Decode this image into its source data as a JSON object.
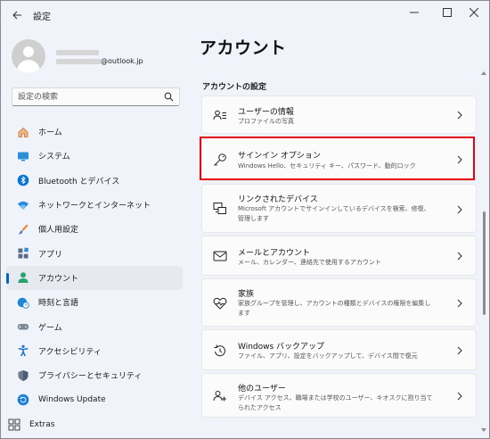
{
  "window": {
    "app_title": "設定",
    "back_icon": "back-arrow-icon",
    "minimize_icon": "minimize-icon",
    "maximize_icon": "maximize-icon",
    "close_icon": "close-icon"
  },
  "profile": {
    "email_suffix": "@outlook.jp"
  },
  "search": {
    "placeholder": "設定の検索"
  },
  "nav": {
    "items": [
      {
        "label": "ホーム",
        "icon": "home-icon"
      },
      {
        "label": "システム",
        "icon": "system-icon"
      },
      {
        "label": "Bluetooth とデバイス",
        "icon": "bluetooth-icon"
      },
      {
        "label": "ネットワークとインターネット",
        "icon": "wifi-icon"
      },
      {
        "label": "個人用設定",
        "icon": "brush-icon"
      },
      {
        "label": "アプリ",
        "icon": "apps-icon"
      },
      {
        "label": "アカウント",
        "icon": "account-icon",
        "active": true
      },
      {
        "label": "時刻と言語",
        "icon": "globe-clock-icon"
      },
      {
        "label": "ゲーム",
        "icon": "gamepad-icon"
      },
      {
        "label": "アクセシビリティ",
        "icon": "accessibility-icon"
      },
      {
        "label": "プライバシーとセキュリティ",
        "icon": "shield-icon"
      },
      {
        "label": "Windows Update",
        "icon": "update-icon"
      }
    ],
    "extras": "Extras"
  },
  "main": {
    "title": "アカウント",
    "section": "アカウントの設定",
    "cards": [
      {
        "title": "ユーザーの情報",
        "desc": "プロファイルの写真",
        "icon": "user-info-icon"
      },
      {
        "title": "サインイン オプション",
        "desc": "Windows Hello、セキュリティ キー、パスワード、動的ロック",
        "icon": "key-icon"
      },
      {
        "title": "リンクされたデバイス",
        "desc": "Microsoft アカウントでサインインしているデバイスを検索、修復、管理します",
        "icon": "linked-devices-icon"
      },
      {
        "title": "メールとアカウント",
        "desc": "メール、カレンダー、連絡先で使用するアカウント",
        "icon": "mail-icon"
      },
      {
        "title": "家族",
        "desc": "家族グループを管理し、アカウントの種類とデバイスの権限を編集します",
        "icon": "family-heart-icon"
      },
      {
        "title": "Windows バックアップ",
        "desc": "ファイル、アプリ、設定をバックアップして、デバイス間で復元",
        "icon": "backup-icon"
      },
      {
        "title": "他のユーザー",
        "desc": "デバイス アクセス、職場または学校のユーザー、キオスクに割り当てられたアクセス",
        "icon": "other-users-icon"
      }
    ]
  },
  "colors": {
    "accent": "#0067c0",
    "highlight_box": "#e60012"
  }
}
